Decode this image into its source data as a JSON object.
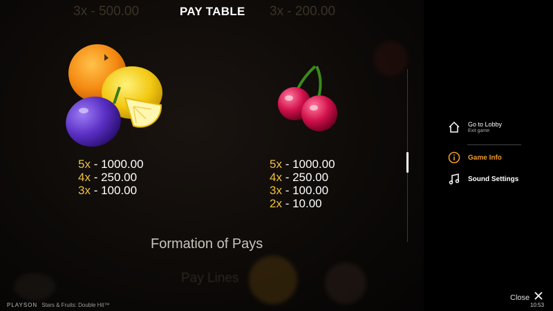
{
  "header": {
    "title": "PAY TABLE",
    "faded_left": "3x - 500.00",
    "faded_right": "3x - 200.00"
  },
  "paytable": {
    "left_group": {
      "icon": "orange-lemon-plum-icon",
      "rows": [
        {
          "mult": "5x",
          "sep": " - ",
          "amount": "1000.00"
        },
        {
          "mult": "4x",
          "sep": " - ",
          "amount": "250.00"
        },
        {
          "mult": "3x",
          "sep": " - ",
          "amount": "100.00"
        }
      ]
    },
    "right_group": {
      "icon": "cherry-icon",
      "rows": [
        {
          "mult": "5x",
          "sep": " - ",
          "amount": "1000.00"
        },
        {
          "mult": "4x",
          "sep": " - ",
          "amount": "250.00"
        },
        {
          "mult": "3x",
          "sep": " - ",
          "amount": "100.00"
        },
        {
          "mult": "2x",
          "sep": " - ",
          "amount": "10.00"
        }
      ]
    },
    "section_title": "Formation of Pays",
    "next_section_faded": "Pay Lines"
  },
  "sidebar": {
    "lobby": {
      "label": "Go to Lobby",
      "sub": "Exit game",
      "icon": "home-icon"
    },
    "info": {
      "label": "Game Info",
      "icon": "info-icon"
    },
    "sound": {
      "label": "Sound Settings",
      "icon": "music-note-icon"
    },
    "close_label": "Close",
    "time": "10:53"
  },
  "footer": {
    "brand": "PLAYSON",
    "game_name": "Stars & Fruits: Double Hit™"
  },
  "colors": {
    "accent_gold": "#f0c23a",
    "active_orange": "#f29b2a"
  }
}
